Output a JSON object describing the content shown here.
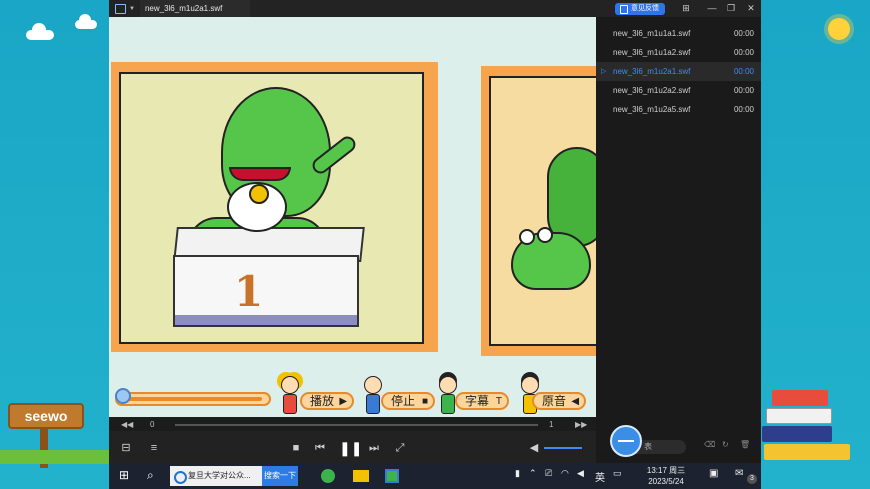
{
  "player": {
    "file_tab": "new_3l6_m1u2a1.swf",
    "feedback_label": "意见反馈"
  },
  "video": {
    "podium_number": "1",
    "buttons": {
      "play": "播放",
      "stop": "停止",
      "subtitle": "字幕",
      "original": "原音"
    }
  },
  "seekbar": {
    "start_count": "0",
    "end_count": "1"
  },
  "playlist": {
    "items": [
      {
        "name": "new_3l6_m1u1a1.swf",
        "duration": "00:00",
        "active": false
      },
      {
        "name": "new_3l6_m1u1a2.swf",
        "duration": "00:00",
        "active": false
      },
      {
        "name": "new_3l6_m1u2a1.swf",
        "duration": "00:00",
        "active": true
      },
      {
        "name": "new_3l6_m1u2a2.swf",
        "duration": "00:00",
        "active": false
      },
      {
        "name": "new_3l6_m1u2a5.swf",
        "duration": "00:00",
        "active": false
      }
    ],
    "search_tail": "表"
  },
  "desktop": {
    "seewo_sign": "seewo"
  },
  "taskbar": {
    "search_text": "复旦大学对公众...",
    "search_button": "搜索一下",
    "ime_label": "英",
    "clock_time": "13:17 周三",
    "clock_date": "2023/5/24",
    "notification_count": "3"
  },
  "colors": {
    "accent": "#2f74e8",
    "active_item": "#3d8cf5",
    "frog_green": "#56c64a",
    "frame_orange": "#f6a54e"
  }
}
